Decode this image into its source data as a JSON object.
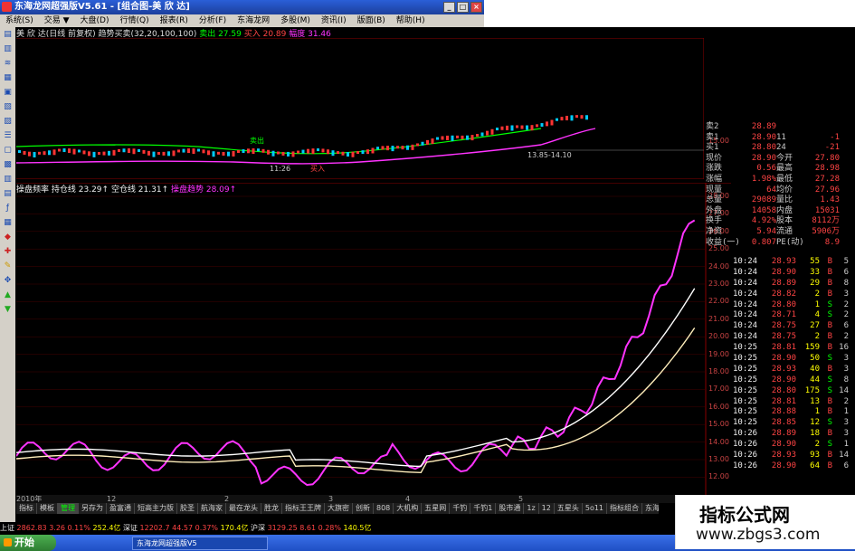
{
  "window": {
    "title": "东海龙网超强版V5.61 - [组合图-美 欣 达]"
  },
  "menu": [
    "系统(S)",
    "交易 ▼",
    "大盘(D)",
    "行情(Q)",
    "报表(R)",
    "分析(F)",
    "东海龙网",
    "多股(M)",
    "资讯(I)",
    "版面(B)",
    "帮助(H)"
  ],
  "top_indicator": {
    "name": "美 欣 达(日线 前复权) 趋势买卖(32,20,100,100)",
    "sell": "卖出 27.59",
    "buy": "买入 20.89",
    "range": "幅度 31.46"
  },
  "chart1_labels": {
    "sell_label": "卖出",
    "buy_label": "买入",
    "date_label": "11:26",
    "price_label": "13.85-14.10"
  },
  "chart1_axis": [
    "15.00"
  ],
  "ind2": {
    "a": "操盘频率",
    "b": "持仓线 23.29↑",
    "c": "空仓线 21.31↑",
    "d": "操盘趋势 28.09↑"
  },
  "chart2_axis": [
    "28.00",
    "27.00",
    "26.00",
    "25.00",
    "24.00",
    "23.00",
    "22.00",
    "21.00",
    "20.00",
    "19.00",
    "18.00",
    "17.00",
    "16.00",
    "15.00",
    "14.00",
    "13.00",
    "12.00"
  ],
  "chart2_xaxis": [
    "2010年",
    "12",
    "2",
    "3",
    "4",
    "5"
  ],
  "quote": [
    {
      "l": "卖2",
      "v": "28.89",
      "n": "",
      "c": ""
    },
    {
      "l": "卖1",
      "v": "28.90",
      "n": "11",
      "c": "-1"
    },
    {
      "l": "买1",
      "v": "28.80",
      "n": "24",
      "c": "-21"
    },
    {
      "l": "现价",
      "v": "28.90",
      "n": "今开",
      "c": "27.80"
    },
    {
      "l": "涨跌",
      "v": "0.56",
      "n": "最高",
      "c": "28.98"
    },
    {
      "l": "涨幅",
      "v": "1.98%",
      "n": "最低",
      "c": "27.28"
    },
    {
      "l": "现量",
      "v": "64",
      "n": "均价",
      "c": "27.96"
    },
    {
      "l": "总量",
      "v": "29089",
      "n": "量比",
      "c": "1.43"
    },
    {
      "l": "外盘",
      "v": "14058",
      "n": "内盘",
      "c": "15031"
    },
    {
      "l": "换手",
      "v": "4.92%",
      "n": "股本",
      "c": "8112万"
    },
    {
      "l": "净资",
      "v": "5.94",
      "n": "流通",
      "c": "5906万"
    },
    {
      "l": "收益(一)",
      "v": "0.807",
      "n": "PE(动)",
      "c": "8.9"
    }
  ],
  "ticks": [
    [
      "10:24",
      "28.93",
      "55",
      "B",
      "5"
    ],
    [
      "10:24",
      "28.90",
      "33",
      "B",
      "6"
    ],
    [
      "10:24",
      "28.89",
      "29",
      "B",
      "8"
    ],
    [
      "10:24",
      "28.82",
      "2",
      "B",
      "3"
    ],
    [
      "10:24",
      "28.80",
      "1",
      "S",
      "2"
    ],
    [
      "10:24",
      "28.71",
      "4",
      "S",
      "2"
    ],
    [
      "10:24",
      "28.75",
      "27",
      "B",
      "6"
    ],
    [
      "10:24",
      "28.75",
      "2",
      "B",
      "2"
    ],
    [
      "10:25",
      "28.81",
      "159",
      "B",
      "16"
    ],
    [
      "10:25",
      "28.90",
      "50",
      "S",
      "3"
    ],
    [
      "10:25",
      "28.93",
      "40",
      "B",
      "3"
    ],
    [
      "10:25",
      "28.90",
      "44",
      "S",
      "8"
    ],
    [
      "10:25",
      "28.80",
      "175",
      "S",
      "14"
    ],
    [
      "10:25",
      "28.81",
      "13",
      "B",
      "2"
    ],
    [
      "10:25",
      "28.88",
      "1",
      "B",
      "1"
    ],
    [
      "10:25",
      "28.85",
      "12",
      "S",
      "3"
    ],
    [
      "10:26",
      "28.89",
      "18",
      "B",
      "3"
    ],
    [
      "10:26",
      "28.90",
      "2",
      "S",
      "1"
    ],
    [
      "10:26",
      "28.93",
      "93",
      "B",
      "14"
    ],
    [
      "10:26",
      "28.90",
      "64",
      "B",
      "6"
    ]
  ],
  "tabs": [
    "指标",
    "模板",
    "管理",
    "另存为",
    "盈富通",
    "短高主力版",
    "胶圣",
    "航海家",
    "最在龙头",
    "胜龙",
    "指标王王牌",
    "大旗密",
    "创新",
    "808",
    "大机构",
    "五星网",
    "千钓",
    "千钓1",
    "股市通",
    "1z",
    "12",
    "五星头",
    "5o11",
    "指标组合",
    "东海证券长枣二"
  ],
  "status": {
    "sh": "上证",
    "sh_v": "2862.83",
    "sh_c": "3.26",
    "sh_p": "0.11%",
    "sh_amt": "252.4亿",
    "sz": "深证",
    "sz_v": "12202.7",
    "sz_c": "44.57",
    "sz_p": "0.37%",
    "sz_amt": "170.4亿",
    "hs": "沪深",
    "hs_v": "3129.25",
    "hs_c": "8.61",
    "hs_p": "0.28%",
    "hs_amt": "140.5亿"
  },
  "taskbar": {
    "start": "开始",
    "item": "东海龙网超强版V5"
  },
  "watermark": {
    "line1": "指标公式网",
    "line2": "www.zbgs3.com"
  },
  "colors": {
    "price_up": "#ff4444",
    "buy_sell_line": "#00ff00",
    "trend": "#ff33ff",
    "hold_line": "#ffffff",
    "empty_line": "#ffeebb"
  }
}
